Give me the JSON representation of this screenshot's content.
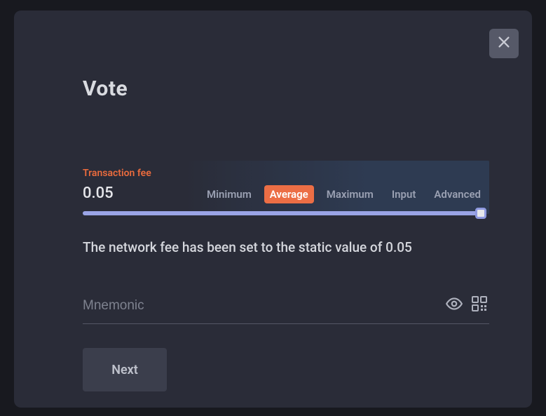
{
  "modal": {
    "title": "Vote",
    "fee": {
      "label": "Transaction fee",
      "value": "0.05",
      "tabs": {
        "minimum": "Minimum",
        "average": "Average",
        "maximum": "Maximum",
        "input": "Input",
        "advanced": "Advanced"
      },
      "active_tab": "average"
    },
    "info": "The network fee has been set to the static value of 0.05",
    "mnemonic": {
      "placeholder": "Mnemonic",
      "value": ""
    },
    "next_label": "Next"
  },
  "colors": {
    "accent": "#ec6e45",
    "slider": "#9aa4e6"
  }
}
